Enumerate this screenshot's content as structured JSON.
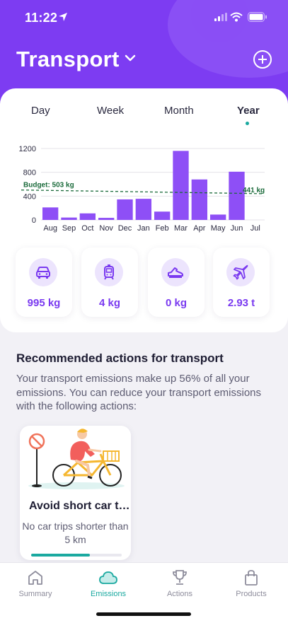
{
  "status_bar": {
    "time": "11:22"
  },
  "header": {
    "title": "Transport"
  },
  "tabs": [
    {
      "label": "Day",
      "selected": false
    },
    {
      "label": "Week",
      "selected": false
    },
    {
      "label": "Month",
      "selected": false
    },
    {
      "label": "Year",
      "selected": true
    }
  ],
  "chart_data": {
    "type": "bar",
    "categories": [
      "Aug",
      "Sep",
      "Oct",
      "Nov",
      "Dec",
      "Jan",
      "Feb",
      "Mar",
      "Apr",
      "May",
      "Jun",
      "Jul"
    ],
    "values": [
      210,
      40,
      110,
      35,
      345,
      355,
      140,
      1160,
      680,
      90,
      810,
      0
    ],
    "ylim": [
      0,
      1200
    ],
    "yticks": [
      "0",
      "400",
      "800",
      "1200"
    ],
    "budget_label": "Budget: 503 kg",
    "budget_start": 503,
    "budget_end": 441,
    "budget_end_label": "441 kg",
    "bar_color": "#8e4ff6",
    "budget_color": "#1b6b3b"
  },
  "stats": [
    {
      "icon": "car-icon",
      "value": "995 kg"
    },
    {
      "icon": "tram-icon",
      "value": "4 kg"
    },
    {
      "icon": "shoe-icon",
      "value": "0 kg"
    },
    {
      "icon": "plane-icon",
      "value": "2.93 t"
    }
  ],
  "recommended": {
    "title": "Recommended actions for transport",
    "description": "Your transport emissions make up 56% of all your emissions. You can reduce your transport emissions with the following actions:",
    "actions": [
      {
        "title": "Avoid short car trips",
        "description": "No car trips shorter than 5 km",
        "progress": 0.65
      }
    ]
  },
  "bottom_nav": [
    {
      "label": "Summary",
      "icon": "home-icon",
      "active": false
    },
    {
      "label": "Emissions",
      "icon": "cloud-icon",
      "active": true
    },
    {
      "label": "Actions",
      "icon": "trophy-icon",
      "active": false
    },
    {
      "label": "Products",
      "icon": "shopping-bag-icon",
      "active": false
    }
  ],
  "colors": {
    "accent": "#7d3cf2",
    "teal": "#1aa9a0"
  }
}
